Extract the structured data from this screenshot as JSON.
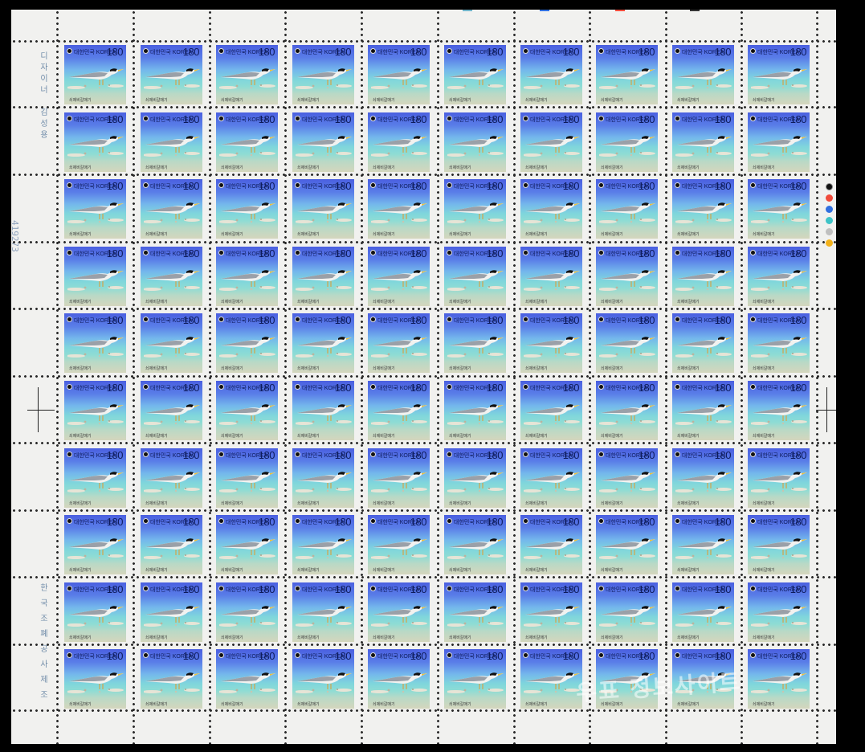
{
  "stamp": {
    "country_label": "대한민국 KOREA",
    "face_value": "180",
    "caption": "쇠제비갈매기",
    "colors": {
      "frame_blue": "#4a5fe0",
      "sea": "#7fd6dc",
      "sand": "#d4d6bd",
      "ink": "#0d1b5a"
    }
  },
  "grid": {
    "rows": 10,
    "columns": 10
  },
  "margin": {
    "left_top_text": [
      "디",
      "자",
      "이",
      "너",
      " ",
      "김",
      "성",
      "용"
    ],
    "left_bottom_text": [
      "한",
      "국",
      "조",
      "폐",
      "공",
      "사",
      "제",
      "조"
    ],
    "serial_number": "419273"
  },
  "color_dots": [
    "#111111",
    "#f04a3a",
    "#2f6fe0",
    "#3fc3c7",
    "#bfbfbf",
    "#f3b21b"
  ],
  "watermark": "우표 정보사이트",
  "icons": {
    "seal": "korea-seal-icon",
    "bird": "tern-bird-icon",
    "registration": "registration-cross-icon"
  }
}
